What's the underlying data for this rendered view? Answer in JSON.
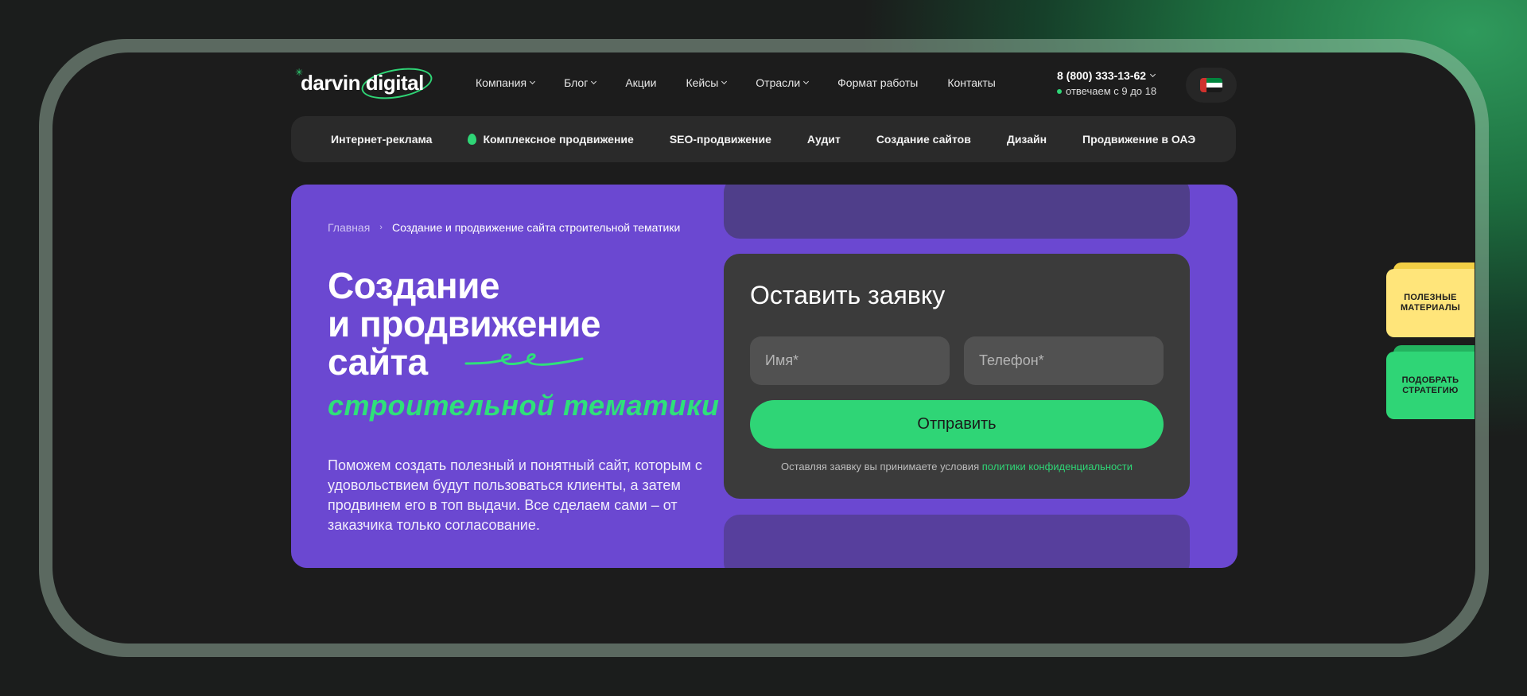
{
  "header": {
    "logo_text": "darvin digital",
    "nav": [
      {
        "label": "Компания",
        "has_dropdown": true
      },
      {
        "label": "Блог",
        "has_dropdown": true
      },
      {
        "label": "Акции",
        "has_dropdown": false
      },
      {
        "label": "Кейсы",
        "has_dropdown": true
      },
      {
        "label": "Отрасли",
        "has_dropdown": true
      },
      {
        "label": "Формат работы",
        "has_dropdown": false
      },
      {
        "label": "Контакты",
        "has_dropdown": false
      }
    ],
    "phone": "8 (800) 333-13-62",
    "hours": "отвечаем с 9 до 18",
    "language_flag": "uae-flag-icon"
  },
  "subnav": {
    "items": [
      {
        "label": "Интернет-реклама"
      },
      {
        "label": "Комплексное продвижение",
        "icon": "drop-icon"
      },
      {
        "label": "SEO-продвижение"
      },
      {
        "label": "Аудит"
      },
      {
        "label": "Создание сайтов"
      },
      {
        "label": "Дизайн"
      },
      {
        "label": "Продвижение в ОАЭ"
      }
    ]
  },
  "hero": {
    "breadcrumb": {
      "home": "Главная",
      "separator": "›",
      "current": "Создание и продвижение сайта строительной тематики"
    },
    "title_lines": [
      "Создание",
      "и продвижение",
      "сайта"
    ],
    "accent": "строительной тематики",
    "description": "Поможем создать полезный и понятный сайт, которым с удовольствием будут пользоваться клиенты, а затем продвинем его в топ выдачи. Все сделаем сами – от заказчика только согласование."
  },
  "form": {
    "title": "Оставить заявку",
    "name_placeholder": "Имя*",
    "phone_placeholder": "Телефон*",
    "submit_label": "Отправить",
    "consent_text": "Оставляя заявку вы принимаете условия",
    "consent_link": "политики конфиденциальности"
  },
  "side_tabs": {
    "materials": "ПОЛЕЗНЫЕ МАТЕРИАЛЫ",
    "strategy": "ПОДОБРАТЬ СТРАТЕГИЮ"
  },
  "colors": {
    "accent_green": "#2fd576",
    "hero_purple": "#6b48d1",
    "yellow": "#ffe57a"
  }
}
